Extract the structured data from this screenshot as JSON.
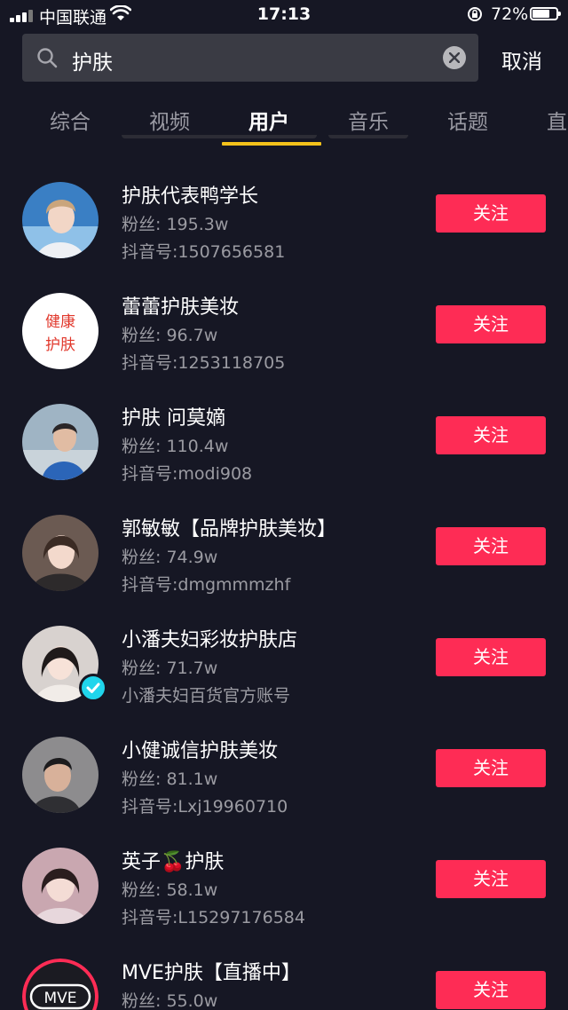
{
  "status_bar": {
    "carrier": "中国联通",
    "time": "17:13",
    "battery": "72%",
    "battery_level": 0.72
  },
  "search": {
    "query": "护肤",
    "cancel_label": "取消"
  },
  "tabs": [
    {
      "label": "综合",
      "active": false
    },
    {
      "label": "视频",
      "active": false
    },
    {
      "label": "用户",
      "active": true
    },
    {
      "label": "音乐",
      "active": false
    },
    {
      "label": "话题",
      "active": false
    },
    {
      "label": "直",
      "active": false
    }
  ],
  "colors": {
    "background": "#161724",
    "follow_button": "#fe2c55",
    "tab_indicator": "#f4c21b",
    "verified_badge": "#20d5ec"
  },
  "users": [
    {
      "name": "护肤代表鸭学长",
      "fans": "粉丝: 195.3w",
      "sub": "抖音号:1507656581",
      "follow_label": "关注"
    },
    {
      "name": "蕾蕾护肤美妆",
      "fans": "粉丝: 96.7w",
      "sub": "抖音号:1253118705",
      "follow_label": "关注",
      "avatar_text": [
        "健康",
        "护肤"
      ]
    },
    {
      "name": "护肤 问莫嫡",
      "fans": "粉丝: 110.4w",
      "sub": "抖音号:modi908",
      "follow_label": "关注"
    },
    {
      "name": "郭敏敏【品牌护肤美妆】",
      "fans": "粉丝: 74.9w",
      "sub": "抖音号:dmgmmmzhf",
      "follow_label": "关注"
    },
    {
      "name": "小潘夫妇彩妆护肤店",
      "fans": "粉丝: 71.7w",
      "sub": "小潘夫妇百货官方账号",
      "follow_label": "关注",
      "verified": true
    },
    {
      "name": "小健诚信护肤美妆",
      "fans": "粉丝: 81.1w",
      "sub": "抖音号:Lxj19960710",
      "follow_label": "关注"
    },
    {
      "name": "英子🍒护肤",
      "fans": "粉丝: 58.1w",
      "sub": "抖音号:L15297176584",
      "follow_label": "关注"
    },
    {
      "name": "MVE护肤【直播中】",
      "fans": "粉丝: 55.0w",
      "sub": "",
      "follow_label": "关注",
      "avatar_text": [
        "MVE"
      ]
    }
  ]
}
